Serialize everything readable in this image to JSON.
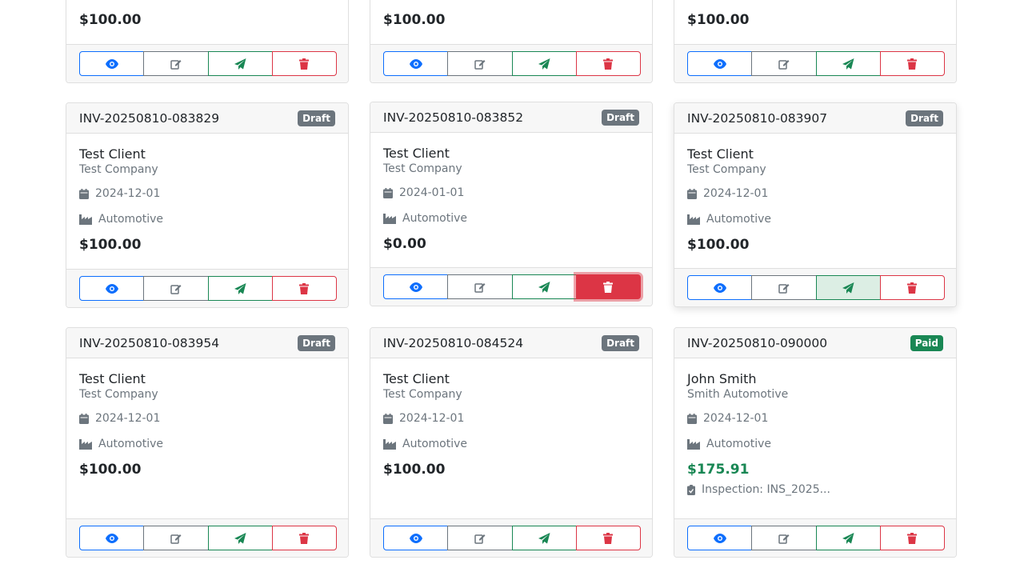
{
  "top_row": [
    {
      "amount": "$100.00"
    },
    {
      "amount": "$100.00"
    },
    {
      "amount": "$100.00"
    }
  ],
  "row2": [
    {
      "invoice": "INV-20250810-083829",
      "status": "Draft",
      "client": "Test Client",
      "company": "Test Company",
      "date": "2024-12-01",
      "industry": "Automotive",
      "amount": "$100.00"
    },
    {
      "invoice": "INV-20250810-083852",
      "status": "Draft",
      "client": "Test Client",
      "company": "Test Company",
      "date": "2024-01-01",
      "industry": "Automotive",
      "amount": "$0.00"
    },
    {
      "invoice": "INV-20250810-083907",
      "status": "Draft",
      "client": "Test Client",
      "company": "Test Company",
      "date": "2024-12-01",
      "industry": "Automotive",
      "amount": "$100.00"
    }
  ],
  "row3": [
    {
      "invoice": "INV-20250810-083954",
      "status": "Draft",
      "client": "Test Client",
      "company": "Test Company",
      "date": "2024-12-01",
      "industry": "Automotive",
      "amount": "$100.00"
    },
    {
      "invoice": "INV-20250810-084524",
      "status": "Draft",
      "client": "Test Client",
      "company": "Test Company",
      "date": "2024-12-01",
      "industry": "Automotive",
      "amount": "$100.00"
    },
    {
      "invoice": "INV-20250810-090000",
      "status": "Paid",
      "client": "John Smith",
      "company": "Smith Automotive",
      "date": "2024-12-01",
      "industry": "Automotive",
      "amount": "$175.91",
      "inspection": "Inspection: INS_2025..."
    }
  ],
  "colors": {
    "primary": "#0d6efd",
    "secondary": "#6c757d",
    "success": "#198754",
    "danger": "#dc3545"
  },
  "icons": {
    "view": "eye-icon",
    "edit": "edit-icon",
    "send": "paper-plane-icon",
    "delete": "trash-icon",
    "date": "calendar-icon",
    "industry": "industry-icon",
    "inspection": "clipboard-check-icon"
  }
}
